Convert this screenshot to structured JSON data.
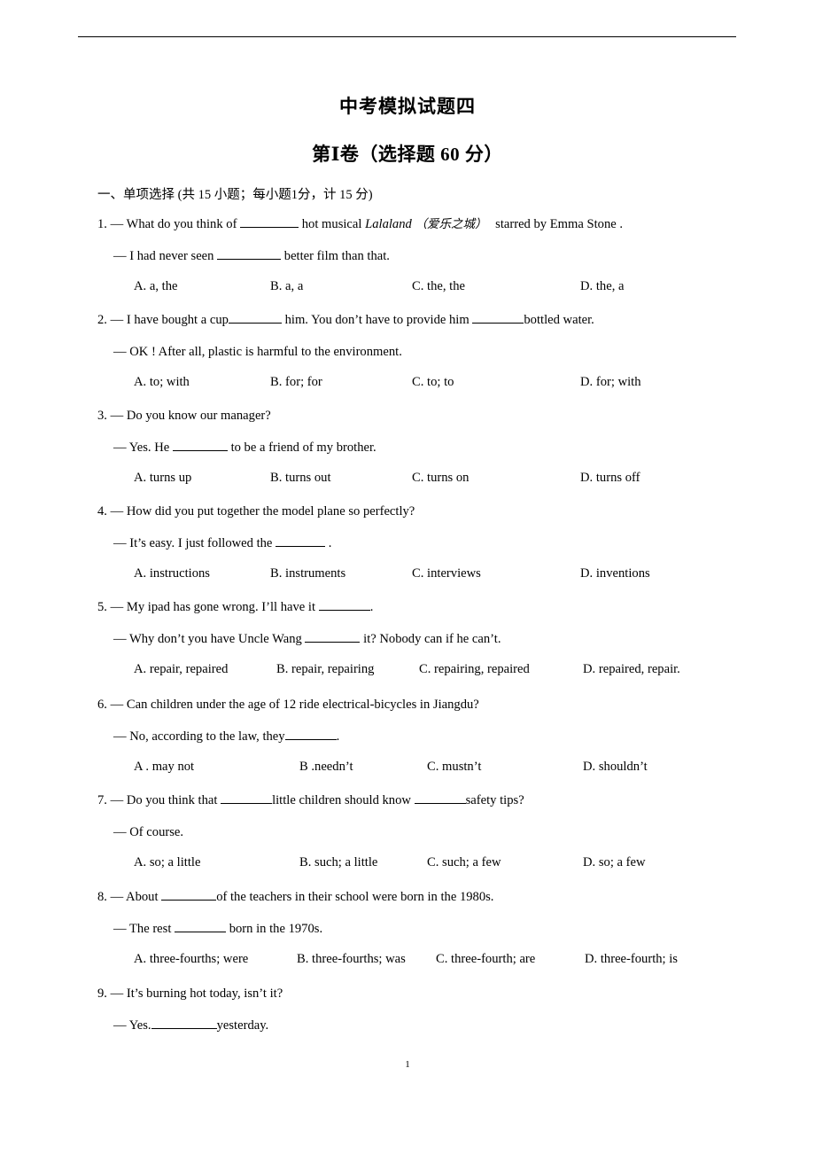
{
  "document": {
    "title": "中考模拟试题四",
    "part_title": "第Ⅰ卷（选择题 60 分）",
    "section_heading": "一、单项选择 (共 15 小题；每小题1分，计 15 分)",
    "page_number": "1"
  },
  "questions": [
    {
      "number": "1.",
      "stem_pre": "— What do you think of",
      "stem_post_a": "hot musical",
      "stem_italic": "Lalaland",
      "stem_cn": "（爱乐之城）",
      "stem_post_b": "starred by Emma Stone .",
      "reply_pre": "— I had never seen",
      "reply_post": "better film than that.",
      "options": [
        {
          "key": "A.",
          "text": "a, the"
        },
        {
          "key": "B.",
          "text": "a, a"
        },
        {
          "key": "C.",
          "text": "the, the"
        },
        {
          "key": "D.",
          "text": "the, a"
        }
      ]
    },
    {
      "number": "2.",
      "stem_pre": "— I have bought a cup",
      "stem_mid": "him. You don’t have to provide him",
      "stem_post": "bottled water.",
      "reply": "— OK ! After all, plastic is harmful to the environment.",
      "options": [
        {
          "key": "A.",
          "text": "to; with"
        },
        {
          "key": "B.",
          "text": "for; for"
        },
        {
          "key": "C.",
          "text": "to; to"
        },
        {
          "key": "D.",
          "text": "for; with"
        }
      ]
    },
    {
      "number": "3.",
      "stem": "— Do you know our manager?",
      "reply_pre": "— Yes. He",
      "reply_post": "to be a friend of my brother.",
      "options": [
        {
          "key": "A.",
          "text": "turns up"
        },
        {
          "key": "B.",
          "text": "turns out"
        },
        {
          "key": "C.",
          "text": "turns on"
        },
        {
          "key": "D.",
          "text": "turns off"
        }
      ]
    },
    {
      "number": "4.",
      "stem": "— How did you put together the model plane so perfectly?",
      "reply_pre": "— It’s easy. I just followed the",
      "reply_post": ".",
      "options": [
        {
          "key": "A.",
          "text": "instructions"
        },
        {
          "key": "B.",
          "text": "instruments"
        },
        {
          "key": "C.",
          "text": "interviews"
        },
        {
          "key": "D.",
          "text": "inventions"
        }
      ]
    },
    {
      "number": "5.",
      "stem_pre": "— My ipad has gone wrong. I’ll have it",
      "stem_post": ".",
      "reply_pre": "— Why don’t you have Uncle Wang",
      "reply_post": "it? Nobody can if he can’t.",
      "options": [
        {
          "key": "A.",
          "text": "repair, repaired"
        },
        {
          "key": "B.",
          "text": "repair, repairing"
        },
        {
          "key": "C.",
          "text": "repairing, repaired"
        },
        {
          "key": "D.",
          "text": "repaired, repair."
        }
      ]
    },
    {
      "number": "6.",
      "stem": "— Can children under the age of 12 ride electrical-bicycles in Jiangdu?",
      "reply_pre": "— No, according to the law, they",
      "reply_post": ".",
      "options": [
        {
          "key": "A .",
          "text": "may not"
        },
        {
          "key": "B .",
          "text": "needn’t"
        },
        {
          "key": "C.",
          "text": "mustn’t"
        },
        {
          "key": "D.",
          "text": "shouldn’t"
        }
      ]
    },
    {
      "number": "7.",
      "stem_pre": "— Do you think that",
      "stem_mid": "little children should know",
      "stem_post": "safety tips?",
      "reply": "— Of course.",
      "options": [
        {
          "key": "A.",
          "text": "so; a little"
        },
        {
          "key": "B.",
          "text": "such; a little"
        },
        {
          "key": "C.",
          "text": "such; a few"
        },
        {
          "key": "D.",
          "text": "so; a few"
        }
      ]
    },
    {
      "number": "8.",
      "stem_pre": "— About",
      "stem_post": "of the teachers in their school were born in the 1980s.",
      "reply_pre": "— The rest",
      "reply_post": "born in the 1970s.",
      "options": [
        {
          "key": "A.",
          "text": "three-fourths; were"
        },
        {
          "key": "B.",
          "text": "three-fourths; was"
        },
        {
          "key": "C.",
          "text": "three-fourth; are"
        },
        {
          "key": "D.",
          "text": "three-fourth; is"
        }
      ]
    },
    {
      "number": "9.",
      "stem": "— It’s burning hot today, isn’t it?",
      "reply_pre": "— Yes.",
      "reply_post": "yesterday."
    }
  ]
}
